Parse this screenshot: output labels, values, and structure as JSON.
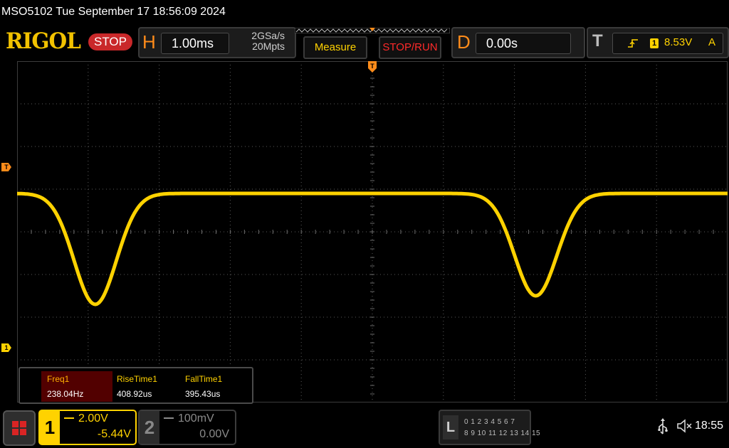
{
  "status_line": "MSO5102  Tue September 17 18:56:09 2024",
  "brand": "RIGOL",
  "run_state": "STOP",
  "horizontal": {
    "letter": "H",
    "timebase": "1.00ms",
    "sample_rate": "2GSa/s",
    "memory_depth": "20Mpts"
  },
  "buttons": {
    "measure": "Measure",
    "stop_run": "STOP/RUN"
  },
  "delay": {
    "letter": "D",
    "value": "0.00s"
  },
  "trigger": {
    "letter": "T",
    "source": "1",
    "level": "8.53V",
    "mode": "A"
  },
  "markers": {
    "trigger_level": "T",
    "channel1_ground": "1"
  },
  "measurements": {
    "headers": [
      "Freq1",
      "RiseTime1",
      "FallTime1"
    ],
    "values": [
      "238.04Hz",
      "408.92us",
      "395.43us"
    ]
  },
  "channels": [
    {
      "num": "1",
      "scale": "2.00V",
      "offset": "-5.44V"
    },
    {
      "num": "2",
      "scale": "100mV",
      "offset": "0.00V"
    }
  ],
  "logic": {
    "letter": "L",
    "row1": "0 1 2 3  4 5 6 7",
    "row2": "8 9 10 11 12 13 14 15"
  },
  "clock": "18:55",
  "icons": {
    "usb": "usb-icon",
    "speaker": "speaker-muted-icon",
    "menu": "menu-grid-icon"
  },
  "colors": {
    "channel1": "#ffd200",
    "accent": "#ff8c1a",
    "stop": "#c9282a"
  },
  "waveform": {
    "baseline_div": 0.9,
    "dips": [
      {
        "time_div": -3.9,
        "depth_div": 2.6
      },
      {
        "time_div": 2.3,
        "depth_div": 2.4
      }
    ]
  }
}
